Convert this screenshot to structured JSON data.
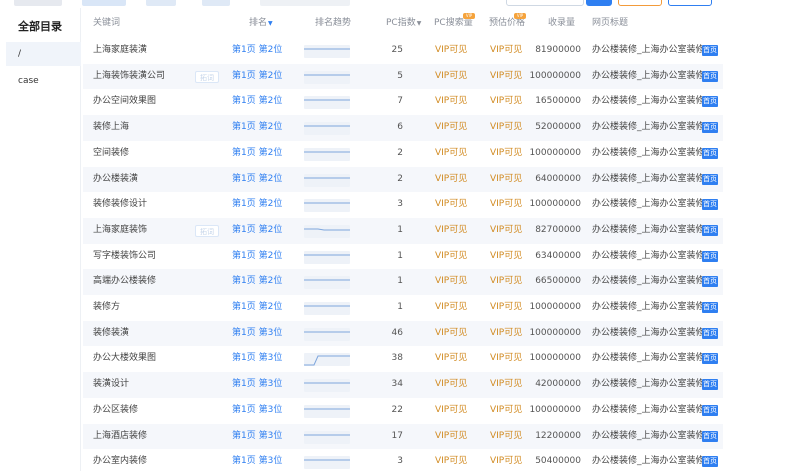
{
  "sidebar": {
    "title": "全部目录",
    "items": [
      {
        "label": "/",
        "active": true
      },
      {
        "label": "case",
        "active": false
      }
    ]
  },
  "table": {
    "headers": {
      "keyword": "关键词",
      "rank": "排名",
      "trend": "排名趋势",
      "pc_index": "PC指数",
      "pc_search": "PC搜索量",
      "est_price": "预估价格",
      "included": "收录量",
      "page_title": "网页标题"
    },
    "vip_badge": "VIP",
    "rows": [
      {
        "keyword": "上海家庭装潢",
        "rank": "第1页 第2位",
        "pc_index": "25",
        "pc_search": "VIP可见",
        "price": "VIP可见",
        "included": "81900000",
        "title": "办公楼装修_上海办公室装修设",
        "tag": "首页",
        "trend": "flat"
      },
      {
        "keyword": "上海装饰装潢公司",
        "rank": "第1页 第2位",
        "pc_index": "5",
        "pc_search": "VIP可见",
        "price": "VIP可见",
        "included": "100000000",
        "title": "办公楼装修_上海办公室装修设",
        "tag": "首页",
        "trend": "flat",
        "faint": "拓词"
      },
      {
        "keyword": "办公空间效果图",
        "rank": "第1页 第2位",
        "pc_index": "7",
        "pc_search": "VIP可见",
        "price": "VIP可见",
        "included": "16500000",
        "title": "办公楼装修_上海办公室装修设",
        "tag": "首页",
        "trend": "flat"
      },
      {
        "keyword": "装修上海",
        "rank": "第1页 第2位",
        "pc_index": "6",
        "pc_search": "VIP可见",
        "price": "VIP可见",
        "included": "52000000",
        "title": "办公楼装修_上海办公室装修设",
        "tag": "首页",
        "trend": "flat"
      },
      {
        "keyword": "空间装修",
        "rank": "第1页 第2位",
        "pc_index": "2",
        "pc_search": "VIP可见",
        "price": "VIP可见",
        "included": "100000000",
        "title": "办公楼装修_上海办公室装修设",
        "tag": "首页",
        "trend": "flat"
      },
      {
        "keyword": "办公楼装潢",
        "rank": "第1页 第2位",
        "pc_index": "2",
        "pc_search": "VIP可见",
        "price": "VIP可见",
        "included": "64000000",
        "title": "办公楼装修_上海办公室装修设",
        "tag": "首页",
        "trend": "flat"
      },
      {
        "keyword": "装修装修设计",
        "rank": "第1页 第2位",
        "pc_index": "3",
        "pc_search": "VIP可见",
        "price": "VIP可见",
        "included": "100000000",
        "title": "办公楼装修_上海办公室装修设",
        "tag": "首页",
        "trend": "flat"
      },
      {
        "keyword": "上海家庭装饰",
        "rank": "第1页 第2位",
        "pc_index": "1",
        "pc_search": "VIP可见",
        "price": "VIP可见",
        "included": "82700000",
        "title": "办公楼装修_上海办公室装修设",
        "tag": "首页",
        "trend": "dip",
        "faint": "拓词"
      },
      {
        "keyword": "写字楼装饰公司",
        "rank": "第1页 第2位",
        "pc_index": "1",
        "pc_search": "VIP可见",
        "price": "VIP可见",
        "included": "63400000",
        "title": "办公楼装修_上海办公室装修设",
        "tag": "首页",
        "trend": "flat"
      },
      {
        "keyword": "高端办公楼装修",
        "rank": "第1页 第2位",
        "pc_index": "1",
        "pc_search": "VIP可见",
        "price": "VIP可见",
        "included": "66500000",
        "title": "办公楼装修_上海办公室装修设",
        "tag": "首页",
        "trend": "flat"
      },
      {
        "keyword": "装修方",
        "rank": "第1页 第2位",
        "pc_index": "1",
        "pc_search": "VIP可见",
        "price": "VIP可见",
        "included": "100000000",
        "title": "办公楼装修_上海办公室装修设",
        "tag": "首页",
        "trend": "flat"
      },
      {
        "keyword": "装修装潢",
        "rank": "第1页 第3位",
        "pc_index": "46",
        "pc_search": "VIP可见",
        "price": "VIP可见",
        "included": "100000000",
        "title": "办公楼装修_上海办公室装修设",
        "tag": "首页",
        "trend": "flat"
      },
      {
        "keyword": "办公大楼效果图",
        "rank": "第1页 第3位",
        "pc_index": "38",
        "pc_search": "VIP可见",
        "price": "VIP可见",
        "included": "100000000",
        "title": "办公楼装修_上海办公室装修设",
        "tag": "首页",
        "trend": "step"
      },
      {
        "keyword": "装潢设计",
        "rank": "第1页 第3位",
        "pc_index": "34",
        "pc_search": "VIP可见",
        "price": "VIP可见",
        "included": "42000000",
        "title": "办公楼装修_上海办公室装修设",
        "tag": "首页",
        "trend": "flat"
      },
      {
        "keyword": "办公区装修",
        "rank": "第1页 第3位",
        "pc_index": "22",
        "pc_search": "VIP可见",
        "price": "VIP可见",
        "included": "100000000",
        "title": "办公楼装修_上海办公室装修设",
        "tag": "首页",
        "trend": "flat"
      },
      {
        "keyword": "上海酒店装修",
        "rank": "第1页 第3位",
        "pc_index": "17",
        "pc_search": "VIP可见",
        "price": "VIP可见",
        "included": "12200000",
        "title": "办公楼装修_上海办公室装修设",
        "tag": "首页",
        "trend": "flat"
      },
      {
        "keyword": "办公室内装修",
        "rank": "第1页 第3位",
        "pc_index": "3",
        "pc_search": "VIP可见",
        "price": "VIP可见",
        "included": "50400000",
        "title": "办公楼装修_上海办公室装修设",
        "tag": "首页",
        "trend": "flat"
      }
    ]
  },
  "colors": {
    "accent": "#2f7ff1",
    "vip_text": "#d18a20",
    "vip_badge": "#f5a33c",
    "row_alt": "#f5f7fb"
  }
}
